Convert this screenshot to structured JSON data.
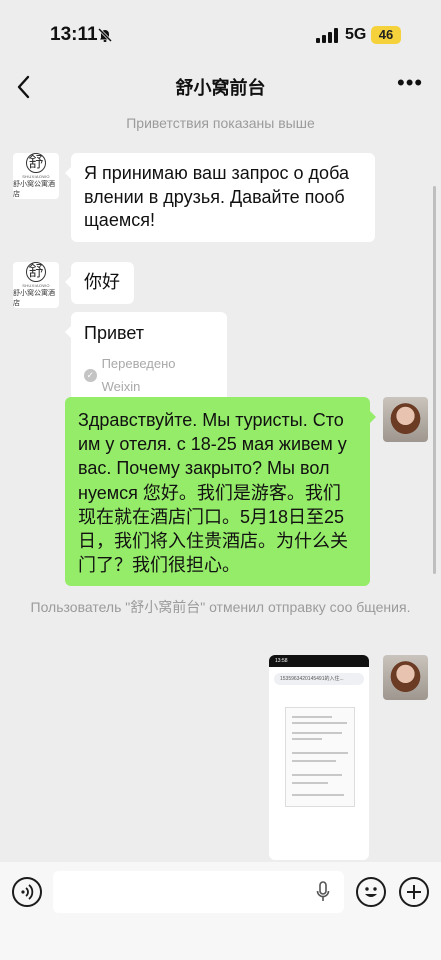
{
  "status_bar": {
    "time": "13:11",
    "network": "5G",
    "battery": "46"
  },
  "chat": {
    "title": "舒小窝前台",
    "icons": {
      "back": "chevron-left-icon",
      "more": "more-icon"
    }
  },
  "messages": {
    "greeting_note": "Приветствия показаны выше",
    "hotel_logo": {
      "glyph": "舒",
      "en": "SHUXIAOWO",
      "cn": "舒小窝公寓酒店"
    },
    "m1": "Я принимаю ваш запрос о доба влении в друзья. Давайте пооб щаемся!",
    "m2": "你好",
    "m3": {
      "text": "Привет",
      "translated": "Переведено Weixin"
    },
    "m4": "Здравствуйте. Мы туристы. Сто им у отеля.  с 18-25 мая живем у вас. Почему закрыто? Мы вол нуемся 您好。我们是游客。我们现在就在酒店门口。5月18日至25日，我们将入住贵酒店。为什么关门了？我们很担心。",
    "recall_note": "Пользователь \"舒小窝前台\" отменил отправку соо бщения.",
    "screenshot": {
      "time": "13:58",
      "url": "1535963420145491的入住..."
    }
  },
  "input": {
    "icons": [
      "voice-icon",
      "microphone-icon",
      "emoji-icon",
      "plus-icon"
    ]
  }
}
